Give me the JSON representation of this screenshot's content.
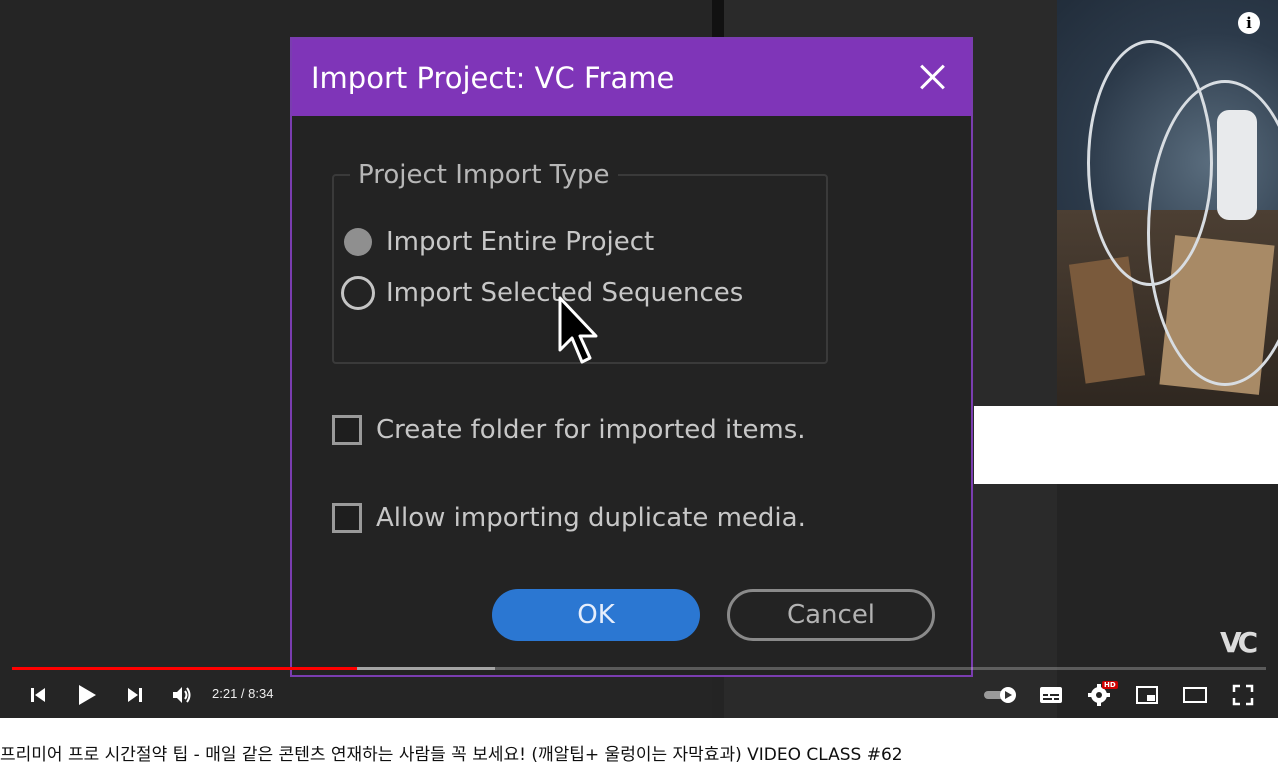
{
  "dialog": {
    "title": "Import Project: VC Frame",
    "group_label": "Project Import Type",
    "radio_options": [
      {
        "label": "Import Entire Project",
        "state": "filled"
      },
      {
        "label": "Import Selected Sequences",
        "state": "ring"
      }
    ],
    "checkboxes": [
      {
        "label": "Create folder for imported items.",
        "checked": false
      },
      {
        "label": "Allow importing duplicate media.",
        "checked": false
      }
    ],
    "ok_label": "OK",
    "cancel_label": "Cancel",
    "accent_color": "#7f35b8"
  },
  "player": {
    "time": "2:21 / 8:34",
    "played_fraction": 0.275,
    "buffered_fraction": 0.385,
    "hd_badge": "HD",
    "logo": "VC",
    "icons": [
      "previous-icon",
      "play-icon",
      "next-icon",
      "volume-icon",
      "autoplay-toggle",
      "subtitles-icon",
      "settings-icon",
      "miniplayer-icon",
      "theater-icon",
      "fullscreen-icon",
      "info-icon"
    ]
  },
  "video_title": "프리미어 프로 시간절약 팁 - 매일 같은 콘텐츠 연재하는 사람들 꼭 보세요! (깨알팁+ 울렁이는 자막효과) VIDEO CLASS #62"
}
